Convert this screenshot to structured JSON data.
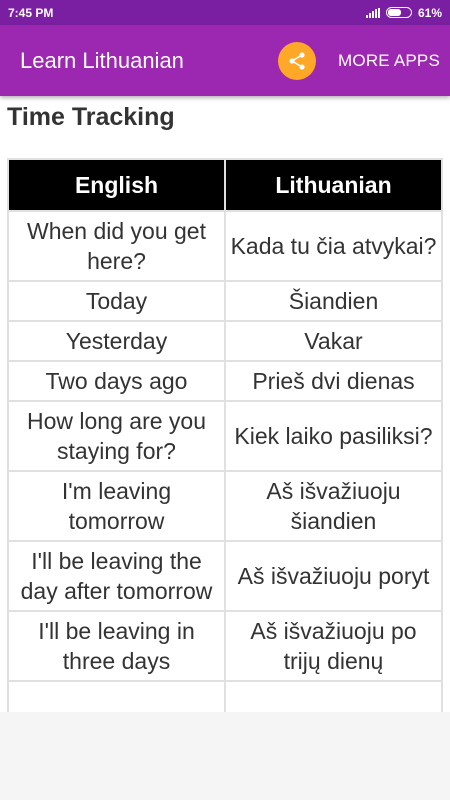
{
  "status": {
    "time": "7:45 PM",
    "battery_text": "61%",
    "battery_level": 0.61
  },
  "app_bar": {
    "title": "Learn Lithuanian",
    "share_icon": "share-icon",
    "more_apps_label": "MORE APPS",
    "colors": {
      "bar": "#9c27b0",
      "status": "#7b1fa2",
      "share": "#ffa726"
    }
  },
  "section": {
    "title": "Time Tracking"
  },
  "table": {
    "headers": {
      "english": "English",
      "lithuanian": "Lithuanian"
    },
    "rows": [
      {
        "english": "When did you get here?",
        "lithuanian": "Kada tu čia atvykai?"
      },
      {
        "english": "Today",
        "lithuanian": "Šiandien"
      },
      {
        "english": "Yesterday",
        "lithuanian": "Vakar"
      },
      {
        "english": "Two days ago",
        "lithuanian": "Prieš dvi dienas"
      },
      {
        "english": "How long are you staying for?",
        "lithuanian": "Kiek laiko pasiliksi?"
      },
      {
        "english": "I'm leaving tomorrow",
        "lithuanian": "Aš išvažiuoju šiandien"
      },
      {
        "english": "I'll be leaving the day after tomorrow",
        "lithuanian": "Aš išvažiuoju poryt"
      },
      {
        "english": "I'll be leaving in three days",
        "lithuanian": "Aš išvažiuoju po trijų dienų"
      },
      {
        "english": "",
        "lithuanian": ""
      }
    ]
  }
}
